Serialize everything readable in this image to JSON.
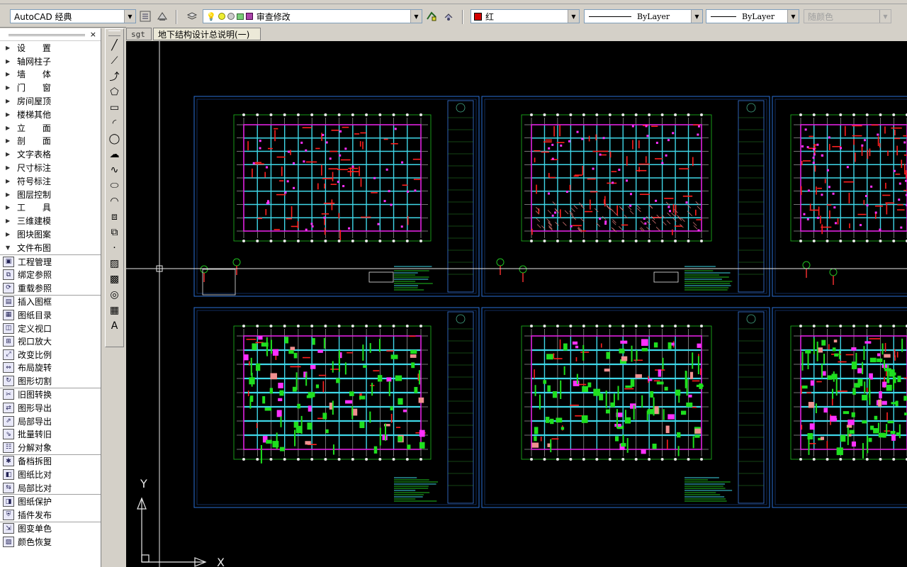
{
  "toolbar": {
    "workspace": "AutoCAD 经典",
    "layer": "审查修改",
    "color": "红",
    "color_hex": "#d40000",
    "linetype": "ByLayer",
    "lineweight": "ByLayer",
    "plotstyle": "随颜色"
  },
  "left_panel": {
    "close_label": "×",
    "menu": [
      {
        "label": "设 置",
        "spaced": true
      },
      {
        "label": "轴网柱子"
      },
      {
        "label": "墙 体",
        "spaced": true
      },
      {
        "label": "门 窗",
        "spaced": true
      },
      {
        "label": "房间屋顶"
      },
      {
        "label": "楼梯其他"
      },
      {
        "label": "立 面",
        "spaced": true
      },
      {
        "label": "剖 面",
        "spaced": true
      },
      {
        "label": "文字表格"
      },
      {
        "label": "尺寸标注"
      },
      {
        "label": "符号标注"
      },
      {
        "label": "图层控制"
      },
      {
        "label": "工 具",
        "spaced": true
      },
      {
        "label": "三维建模"
      },
      {
        "label": "图块图案"
      },
      {
        "label": "文件布图",
        "open": true
      }
    ],
    "commands": [
      [
        "工程管理",
        "绑定参照",
        "重载参照"
      ],
      [
        "插入图框",
        "图纸目录",
        "定义视口",
        "视口放大",
        "改变比例",
        "布局旋转",
        "图形切割"
      ],
      [
        "旧图转换",
        "图形导出",
        "局部导出",
        "批量转旧",
        "分解对象"
      ],
      [
        "备档拆图",
        "图纸比对",
        "局部比对"
      ],
      [
        "图纸保护",
        "插件发布"
      ],
      [
        "图变单色",
        "颜色恢复"
      ]
    ]
  },
  "draw_tools": [
    "line-icon",
    "xline-icon",
    "polyline-icon",
    "polygon-icon",
    "rectangle-icon",
    "arc-icon",
    "circle-icon",
    "revcloud-icon",
    "spline-icon",
    "ellipse-icon",
    "ellipse-arc-icon",
    "insert-block-icon",
    "make-block-icon",
    "point-icon",
    "hatch-icon",
    "gradient-icon",
    "region-icon",
    "table-icon",
    "mtext-icon"
  ],
  "tabs": {
    "inactive": "sgt",
    "active": "地下结构设计总说明(一)"
  },
  "ucs": {
    "x_label": "X",
    "y_label": "Y"
  }
}
